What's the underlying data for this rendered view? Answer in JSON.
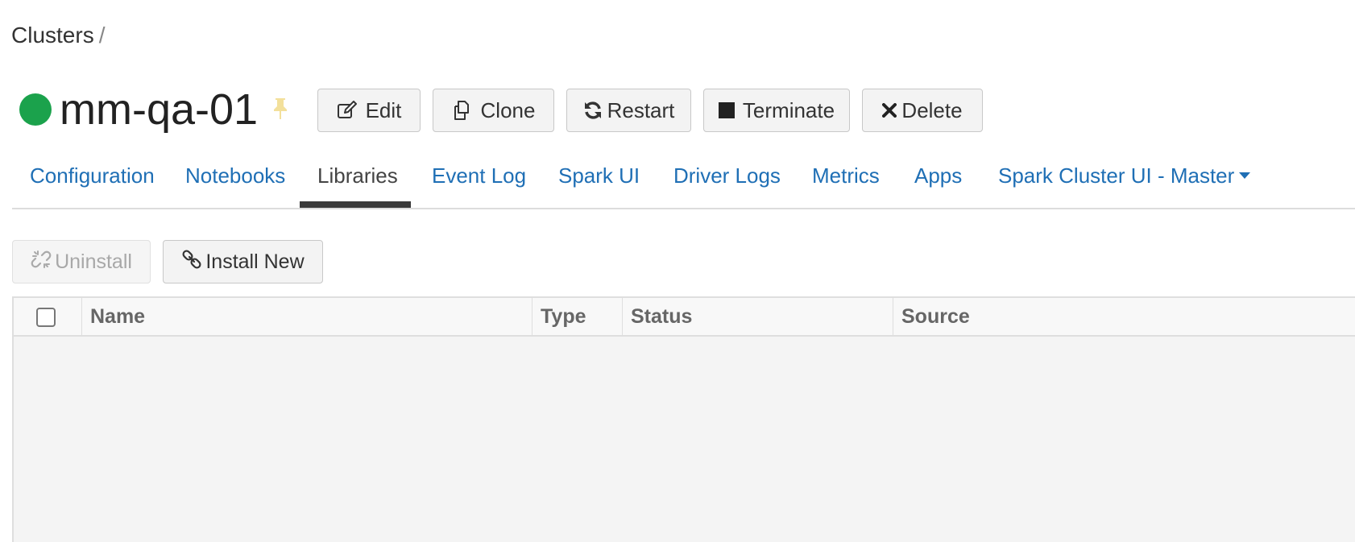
{
  "breadcrumb": {
    "root": "Clusters",
    "separator": "/"
  },
  "cluster": {
    "name": "mm-qa-01",
    "status_color": "#1ba24c",
    "pin_icon": "pin-icon",
    "pin_color": "#f3e09b"
  },
  "actions": {
    "edit": "Edit",
    "clone": "Clone",
    "restart": "Restart",
    "terminate": "Terminate",
    "delete": "Delete"
  },
  "tabs": [
    {
      "label": "Configuration"
    },
    {
      "label": "Notebooks"
    },
    {
      "label": "Libraries",
      "active": true
    },
    {
      "label": "Event Log"
    },
    {
      "label": "Spark UI"
    },
    {
      "label": "Driver Logs"
    },
    {
      "label": "Metrics"
    },
    {
      "label": "Apps"
    },
    {
      "label": "Spark Cluster UI - Master"
    }
  ],
  "libraries": {
    "uninstall_label": "Uninstall",
    "install_label": "Install New",
    "columns": [
      "Name",
      "Type",
      "Status",
      "Source"
    ],
    "rows": []
  },
  "colors": {
    "link": "#1f6fb5",
    "active_tab_underline": "#3a3a3a"
  }
}
